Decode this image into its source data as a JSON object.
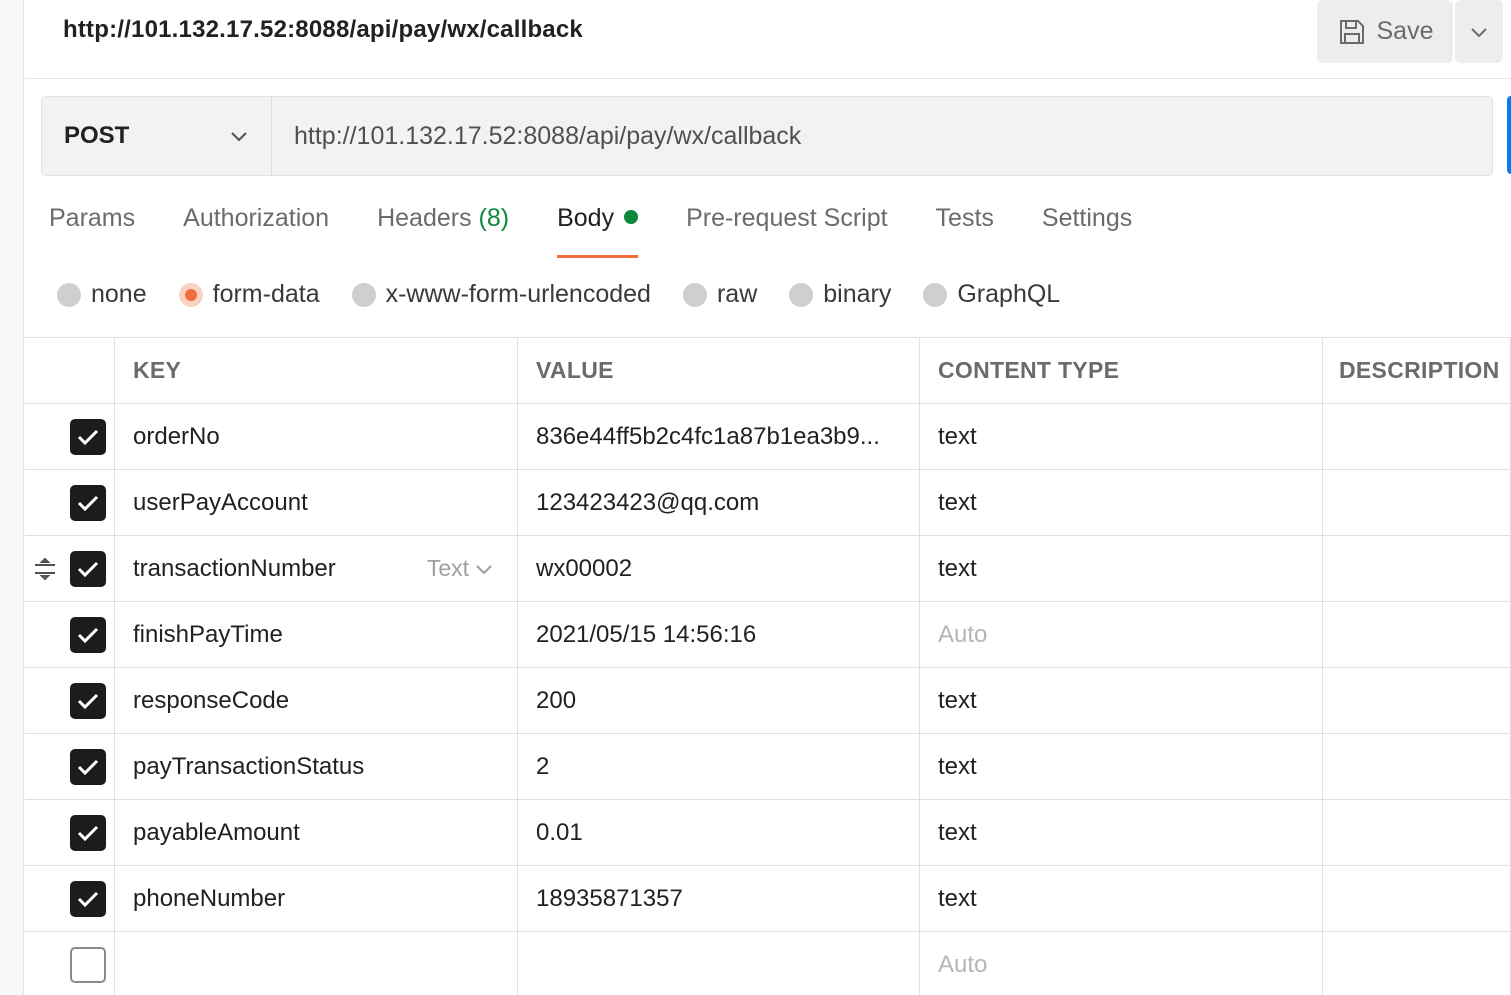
{
  "header": {
    "title": "http://101.132.17.52:8088/api/pay/wx/callback",
    "save_label": "Save"
  },
  "request": {
    "method": "POST",
    "url": "http://101.132.17.52:8088/api/pay/wx/callback"
  },
  "tabs": [
    {
      "label": "Params",
      "count": "",
      "active": false
    },
    {
      "label": "Authorization",
      "count": "",
      "active": false
    },
    {
      "label": "Headers",
      "count": "(8)",
      "active": false
    },
    {
      "label": "Body",
      "count": "",
      "active": true
    },
    {
      "label": "Pre-request Script",
      "count": "",
      "active": false
    },
    {
      "label": "Tests",
      "count": "",
      "active": false
    },
    {
      "label": "Settings",
      "count": "",
      "active": false
    }
  ],
  "body_types": [
    {
      "label": "none",
      "checked": false
    },
    {
      "label": "form-data",
      "checked": true
    },
    {
      "label": "x-www-form-urlencoded",
      "checked": false
    },
    {
      "label": "raw",
      "checked": false
    },
    {
      "label": "binary",
      "checked": false
    },
    {
      "label": "GraphQL",
      "checked": false
    }
  ],
  "table": {
    "headers": {
      "key": "KEY",
      "value": "VALUE",
      "content_type": "CONTENT TYPE",
      "description": "DESCRIPTION"
    },
    "key_type_label": "Text",
    "rows": [
      {
        "checked": true,
        "key": "orderNo",
        "value": "836e44ff5b2c4fc1a87b1ea3b9...",
        "content_type": "text",
        "description": ""
      },
      {
        "checked": true,
        "key": "userPayAccount",
        "value": "123423423@qq.com",
        "content_type": "text",
        "description": ""
      },
      {
        "checked": true,
        "key": "transactionNumber",
        "value": "wx00002",
        "content_type": "text",
        "description": "",
        "hovered": true
      },
      {
        "checked": true,
        "key": "finishPayTime",
        "value": "2021/05/15 14:56:16",
        "content_type": "Auto",
        "description": "",
        "placeholder_type": true
      },
      {
        "checked": true,
        "key": "responseCode",
        "value": "200",
        "content_type": "text",
        "description": ""
      },
      {
        "checked": true,
        "key": "payTransactionStatus",
        "value": "2",
        "content_type": "text",
        "description": ""
      },
      {
        "checked": true,
        "key": "payableAmount",
        "value": "0.01",
        "content_type": "text",
        "description": ""
      },
      {
        "checked": true,
        "key": "phoneNumber",
        "value": "18935871357",
        "content_type": "text",
        "description": ""
      },
      {
        "checked": false,
        "key": "",
        "value": "",
        "content_type": "Auto",
        "description": "",
        "placeholder_type": true
      }
    ]
  },
  "colors": {
    "accent": "#f26b3a",
    "success": "#0b8a3e",
    "primary": "#097bed"
  }
}
